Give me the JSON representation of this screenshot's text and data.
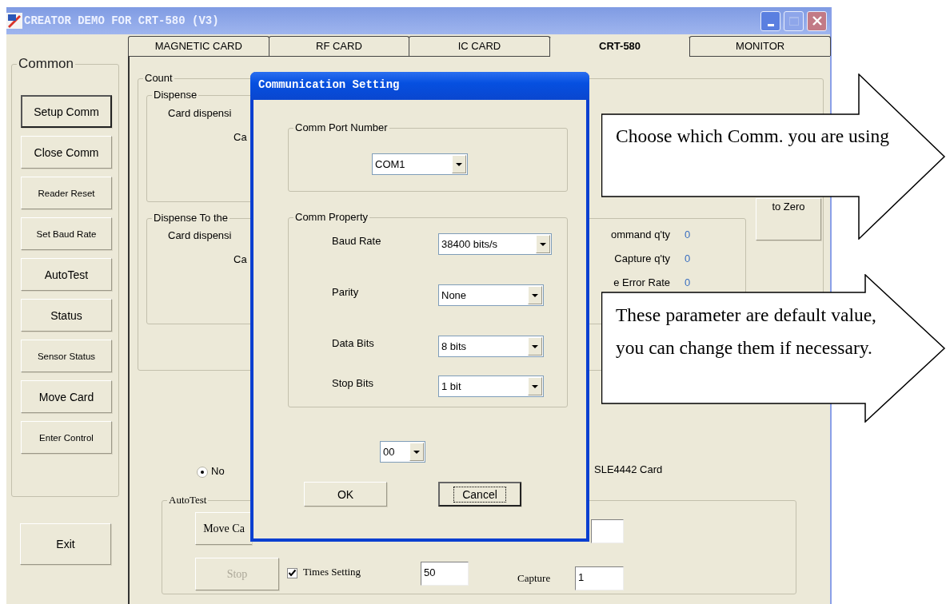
{
  "window": {
    "title": "CREATOR DEMO FOR CRT-580 (V3)"
  },
  "sidebar": {
    "group_label": "Common",
    "buttons": [
      {
        "label": "Setup Comm",
        "focused": true
      },
      {
        "label": "Close Comm",
        "focused": false
      },
      {
        "label": "Reader Reset",
        "focused": false
      },
      {
        "label": "Set Baud Rate",
        "focused": false
      },
      {
        "label": "AutoTest",
        "focused": false
      },
      {
        "label": "Status",
        "focused": false
      },
      {
        "label": "Sensor Status",
        "focused": false
      },
      {
        "label": "Move Card",
        "focused": false
      },
      {
        "label": "Enter Control",
        "focused": false
      }
    ],
    "exit_button": "Exit"
  },
  "tabs": [
    {
      "label": "MAGNETIC CARD",
      "selected": false
    },
    {
      "label": "RF CARD",
      "selected": false
    },
    {
      "label": "IC CARD",
      "selected": false
    },
    {
      "label": "CRT-580",
      "selected": true
    },
    {
      "label": "MONITOR",
      "selected": false
    }
  ],
  "count_panel": {
    "label": "Count",
    "dispense": {
      "label": "Dispense",
      "line_1": "Card dispensi",
      "line_2": "Ca"
    },
    "dispense_to": {
      "label": "Dispense To the",
      "line_1": "Card dispensi",
      "line_2": "Ca"
    },
    "stats": [
      {
        "label": "ommand q'ty",
        "value": "0"
      },
      {
        "label": "Capture q'ty",
        "value": "0"
      },
      {
        "label": "e Error Rate",
        "value": "0"
      }
    ],
    "zero_button": "to Zero"
  },
  "card_type": {
    "radio": {
      "label": "No",
      "selected": true
    },
    "option_label": "SLE4442 Card"
  },
  "autotest": {
    "label": "AutoTest",
    "move_button": "Move Ca",
    "stop_button": {
      "label": "Stop",
      "disabled": true
    },
    "times_setting": {
      "label": "Times Setting",
      "checked": true,
      "value": "50"
    },
    "capture": {
      "label": "Capture",
      "value": "1"
    }
  },
  "dialog": {
    "title": "Communication Setting",
    "port_group": {
      "label": "Comm Port Number",
      "value": "COM1"
    },
    "property_group": {
      "label": "Comm Property",
      "fields": [
        {
          "label": "Baud Rate",
          "value": "38400 bits/s"
        },
        {
          "label": "Parity",
          "value": "None"
        },
        {
          "label": "Data Bits",
          "value": "8 bits"
        },
        {
          "label": "Stop Bits",
          "value": "1 bit"
        }
      ]
    },
    "address": "00",
    "buttons": [
      {
        "label": "OK",
        "focused": false
      },
      {
        "label": "Cancel",
        "focused": true
      }
    ]
  },
  "callouts": [
    {
      "text": "Choose which Comm. you are using"
    },
    {
      "text": "These parameter are default value, you can change them if necessary."
    }
  ]
}
